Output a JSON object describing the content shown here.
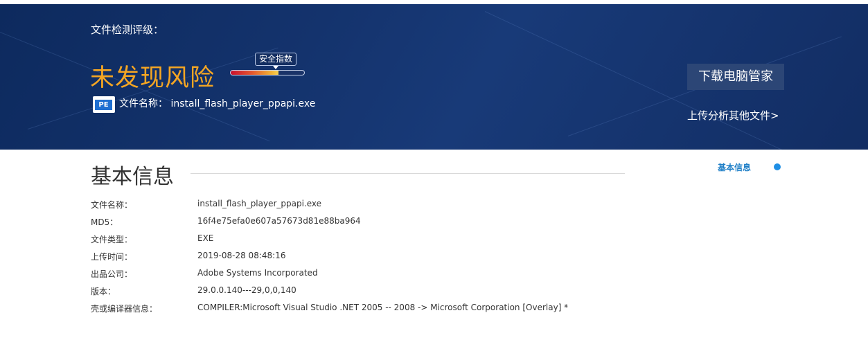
{
  "banner": {
    "verdict_label": "文件检测评级：",
    "verdict": "未发现风险",
    "safety_label": "安全指数",
    "safety_level": 0.65,
    "file_icon_label": "PE",
    "file_name_label": "文件名称：",
    "file_name": "install_flash_player_ppapi.exe",
    "download_button": "下载电脑管家",
    "upload_link": "上传分析其他文件>",
    "colors": {
      "verdict": "#f5a623",
      "background": "#14336d"
    }
  },
  "basic_info": {
    "title": "基本信息",
    "nav_link": "基本信息",
    "rows": [
      {
        "key": "文件名称：",
        "value": "install_flash_player_ppapi.exe"
      },
      {
        "key": "MD5：",
        "value": "16f4e75efa0e607a57673d81e88ba964"
      },
      {
        "key": "文件类型：",
        "value": "EXE"
      },
      {
        "key": "上传时间：",
        "value": "2019-08-28 08:48:16"
      },
      {
        "key": "出品公司：",
        "value": "Adobe Systems Incorporated"
      },
      {
        "key": "版本：",
        "value": "29.0.0.140---29,0,0,140"
      },
      {
        "key": "壳或编译器信息：",
        "value": "COMPILER:Microsoft Visual Studio .NET 2005 -- 2008 -> Microsoft Corporation [Overlay] *"
      }
    ]
  }
}
